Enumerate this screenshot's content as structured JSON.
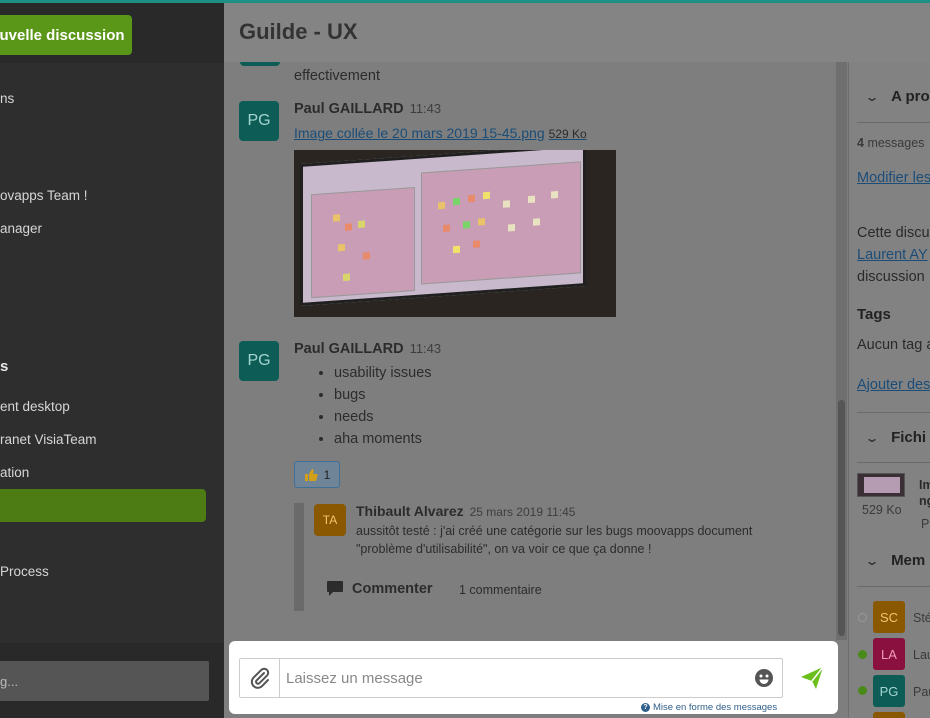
{
  "sidebar": {
    "new_discussion": "uvelle discussion",
    "items": [
      {
        "label": "ns"
      },
      {
        "label": "ovapps Team !"
      },
      {
        "label": "anager"
      },
      {
        "label": "ent desktop"
      },
      {
        "label": "ranet VisiaTeam"
      },
      {
        "label": "ation"
      },
      {
        "label": "Process"
      }
    ],
    "section": "s",
    "search_placeholder": "g..."
  },
  "header": {
    "title": "Guilde - UX"
  },
  "feed": {
    "cont_text": "effectivement",
    "messages": [
      {
        "initials": "PG",
        "author": "Paul GAILLARD",
        "time": "11:43",
        "file_name": "Image collée le 20 mars 2019 15-45.png",
        "file_size": "529 Ko"
      },
      {
        "initials": "PG",
        "author": "Paul GAILLARD",
        "time": "11:43",
        "bullets": [
          "usability issues",
          "bugs",
          "needs",
          "aha moments"
        ],
        "reaction_count": "1"
      }
    ],
    "comment": {
      "initials": "TA",
      "author": "Thibault Alvarez",
      "date": "25 mars 2019 11:45",
      "text": "aussitôt testé : j'ai créé une catégorie sur les bugs moovapps document \"problème d'utilisabilité\", on va voir ce que ça donne !"
    },
    "comment_button": "Commenter",
    "comment_count": "1 commentaire"
  },
  "composer": {
    "placeholder": "Laissez un message",
    "format_hint": "Mise en forme des messages"
  },
  "right_panel": {
    "about_title": "A pro",
    "message_count_num": "4",
    "message_count_label": "messages",
    "modify_link": "Modifier les",
    "desc_line1": "Cette discu",
    "desc_link": "Laurent AY",
    "desc_line3": "discussion",
    "tags_title": "Tags",
    "tags_empty": "Aucun tag a",
    "add_tags": "Ajouter des",
    "files_title": "Fichi",
    "file_name_1": "Im",
    "file_name_2": "ng",
    "file_size": "529 Ko",
    "file_by": "Pa",
    "members_title": "Mem",
    "members": [
      {
        "initials": "SC",
        "name": "Sté",
        "online": false
      },
      {
        "initials": "LA",
        "name": "Lau",
        "online": true
      },
      {
        "initials": "PG",
        "name": "Pau",
        "online": true
      }
    ]
  },
  "colors": {
    "accent_green": "#5a9617",
    "teal": "#1d8f84",
    "link": "#1b4d78",
    "send": "#6bbf1a"
  }
}
